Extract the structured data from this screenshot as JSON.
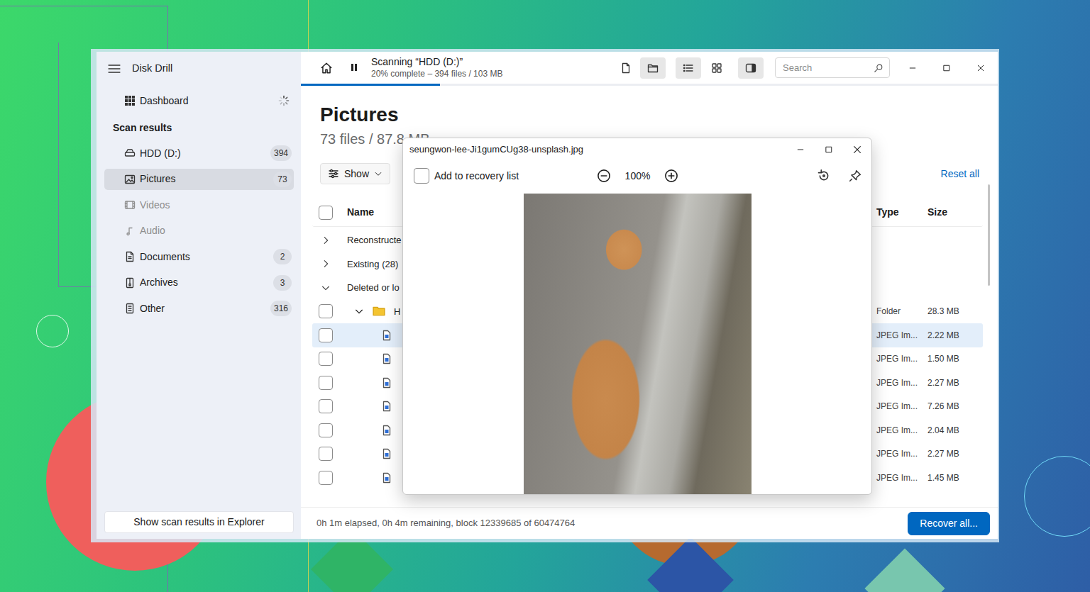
{
  "window": {
    "title": "Disk Drill"
  },
  "sidebar": {
    "dashboard": {
      "label": "Dashboard",
      "busy": true
    },
    "section": "Scan results",
    "items": [
      {
        "kind": "drive",
        "label": "HDD (D:)",
        "count": "394",
        "selected": false,
        "disabled": false
      },
      {
        "kind": "pictures",
        "label": "Pictures",
        "count": "73",
        "selected": true,
        "disabled": false
      },
      {
        "kind": "videos",
        "label": "Videos",
        "count": null,
        "selected": false,
        "disabled": true
      },
      {
        "kind": "audio",
        "label": "Audio",
        "count": null,
        "selected": false,
        "disabled": true
      },
      {
        "kind": "documents",
        "label": "Documents",
        "count": "2",
        "selected": false,
        "disabled": false
      },
      {
        "kind": "archives",
        "label": "Archives",
        "count": "3",
        "selected": false,
        "disabled": false
      },
      {
        "kind": "other",
        "label": "Other",
        "count": "316",
        "selected": false,
        "disabled": false
      }
    ],
    "footer_button": "Show scan results in Explorer"
  },
  "scan": {
    "title": "Scanning “HDD (D:)”",
    "subtitle": "20% complete – 394 files / 103 MB",
    "level": 0.2,
    "paused": false
  },
  "views": [
    {
      "kind": "file",
      "selected": false
    },
    {
      "kind": "folder",
      "selected": true
    },
    {
      "kind": "list",
      "selected": true
    },
    {
      "kind": "grid",
      "selected": false
    },
    {
      "kind": "panel",
      "selected": true
    }
  ],
  "search": {
    "placeholder": "Search"
  },
  "content": {
    "title": "Pictures",
    "summary": "73 files / 87.8 MB",
    "filter_button": "Show",
    "reset": "Reset all"
  },
  "table": {
    "columns": [
      "Name",
      "Type",
      "Size"
    ],
    "header_checked": false,
    "groups": [
      {
        "label": "Reconstructe",
        "expanded": false
      },
      {
        "label": "Existing (28)",
        "expanded": false
      },
      {
        "label": "Deleted or lo",
        "expanded": true
      }
    ],
    "rows": [
      {
        "kind": "folder",
        "name": "H",
        "type": "Folder",
        "size": "28.3 MB",
        "checked": false,
        "selected": false,
        "expanded": true
      },
      {
        "kind": "file",
        "type": "JPEG Im...",
        "size": "2.22 MB",
        "checked": false,
        "selected": true
      },
      {
        "kind": "file",
        "type": "JPEG Im...",
        "size": "1.50 MB",
        "checked": false,
        "selected": false
      },
      {
        "kind": "file",
        "type": "JPEG Im...",
        "size": "2.27 MB",
        "checked": false,
        "selected": false
      },
      {
        "kind": "file",
        "type": "JPEG Im...",
        "size": "7.26 MB",
        "checked": false,
        "selected": false
      },
      {
        "kind": "file",
        "type": "JPEG Im...",
        "size": "2.04 MB",
        "checked": false,
        "selected": false
      },
      {
        "kind": "file",
        "type": "JPEG Im...",
        "size": "2.27 MB",
        "checked": false,
        "selected": false
      },
      {
        "kind": "file",
        "type": "JPEG Im...",
        "size": "1.45 MB",
        "checked": false,
        "selected": false
      }
    ]
  },
  "preview": {
    "title": "seungwon-lee-Ji1gumCUg38-unsplash.jpg",
    "add_label": "Add to recovery list",
    "add_checked": false,
    "zoom": "100%"
  },
  "status_bar": {
    "text": "0h 1m elapsed, 0h 4m remaining, block 12339685 of 60474764",
    "button": "Recover all..."
  }
}
